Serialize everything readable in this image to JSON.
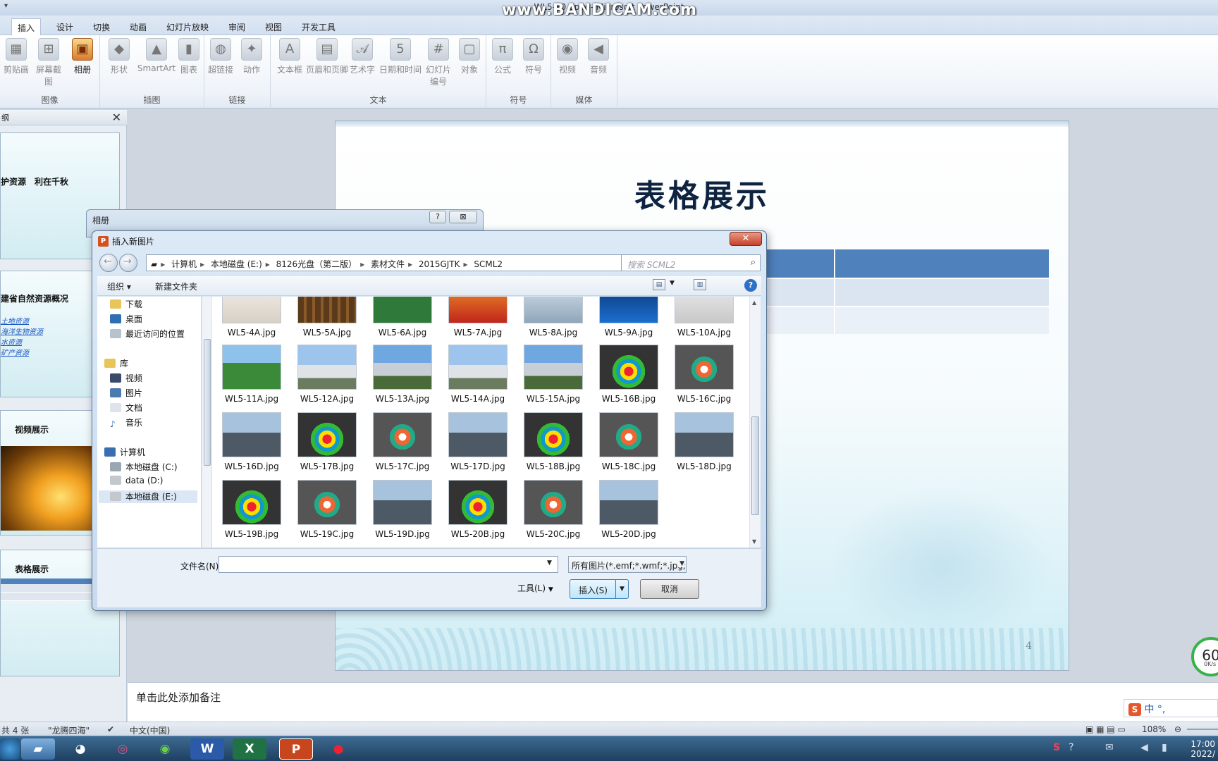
{
  "window": {
    "title": "WL5-10.pptx - Microsoft PowerPoint",
    "watermark": "www.BANDICAM.com"
  },
  "ribbon": {
    "tabs": [
      "插入",
      "设计",
      "切换",
      "动画",
      "幻灯片放映",
      "审阅",
      "视图",
      "开发工具"
    ],
    "groups": [
      {
        "label": "图像",
        "buttons": [
          "剪贴画",
          "屏幕截图",
          "相册"
        ]
      },
      {
        "label": "插图",
        "buttons": [
          "形状",
          "SmartArt",
          "图表"
        ]
      },
      {
        "label": "链接",
        "buttons": [
          "超链接",
          "动作"
        ]
      },
      {
        "label": "文本",
        "buttons": [
          "文本框",
          "页眉和页脚",
          "艺术字",
          "日期和时间",
          "幻灯片\n编号",
          "对象"
        ]
      },
      {
        "label": "符号",
        "buttons": [
          "公式",
          "符号"
        ]
      },
      {
        "label": "媒体",
        "buttons": [
          "视频",
          "音频"
        ]
      }
    ]
  },
  "slides_pane": {
    "tab_label": "纲",
    "thumb1_title": "护资源　利在千秋",
    "thumb2_title": "建省自然资源概况",
    "thumb2_links": [
      "土地资源",
      "海洋生物资源",
      "水资源",
      "矿产资源"
    ],
    "thumb3_title": "视频展示",
    "thumb4_title": "表格展示"
  },
  "slide": {
    "title": "表格展示",
    "page_number": "4"
  },
  "notes": {
    "placeholder": "单击此处添加备注"
  },
  "statusbar": {
    "slide_count": "共 4 张",
    "theme": "\"龙腾四海\"",
    "language": "中文(中国)",
    "zoom": "108%"
  },
  "album_dialog": {
    "title": "相册",
    "help": "?",
    "close": "⊠"
  },
  "insert_dialog": {
    "title": "插入新图片",
    "breadcrumb": [
      "计算机",
      "本地磁盘 (E:)",
      "8126光盘（第二版）",
      "素材文件",
      "2015GJTK",
      "SCML2"
    ],
    "search_placeholder": "搜索 SCML2",
    "organize": "组织 ▾",
    "new_folder": "新建文件夹",
    "nav_items": [
      "下载",
      "桌面",
      "最近访问的位置",
      "库",
      "视频",
      "图片",
      "文档",
      "音乐",
      "计算机",
      "本地磁盘 (C:)",
      "data (D:)",
      "本地磁盘 (E:)"
    ],
    "files": [
      "WL5-4A.jpg",
      "WL5-5A.jpg",
      "WL5-6A.jpg",
      "WL5-7A.jpg",
      "WL5-8A.jpg",
      "WL5-9A.jpg",
      "WL5-10A.jpg",
      "WL5-11A.jpg",
      "WL5-12A.jpg",
      "WL5-13A.jpg",
      "WL5-14A.jpg",
      "WL5-15A.jpg",
      "WL5-16B.jpg",
      "WL5-16C.jpg",
      "WL5-16D.jpg",
      "WL5-17B.jpg",
      "WL5-17C.jpg",
      "WL5-17D.jpg",
      "WL5-18B.jpg",
      "WL5-18C.jpg",
      "WL5-18D.jpg",
      "WL5-19B.jpg",
      "WL5-19C.jpg",
      "WL5-19D.jpg",
      "WL5-20B.jpg",
      "WL5-20C.jpg",
      "WL5-20D.jpg"
    ],
    "filename_label": "文件名(N):",
    "filename_value": "",
    "filetype": "所有图片(*.emf;*.wmf;*.jpg;*.j",
    "tools": "工具(L)",
    "insert": "插入(S)",
    "cancel": "取消"
  },
  "taskbar": {
    "clock_time": "17:00",
    "clock_date": "2022/"
  },
  "speed_widget": {
    "value": "60",
    "rate": "0K/s"
  },
  "ime": "中 °,"
}
